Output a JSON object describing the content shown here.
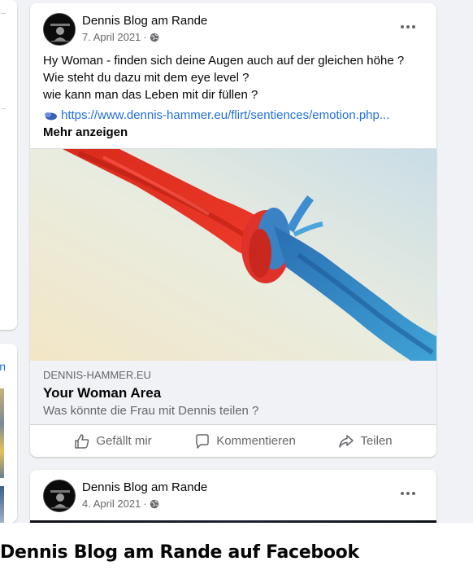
{
  "post1": {
    "page_name": "Dennis Blog am Rande",
    "date": "7. April 2021",
    "meta_sep": "·",
    "lines": [
      "Hy Woman - finden sich deine Augen auch auf der gleichen höhe ?",
      "Wie steht du dazu mit dem eye level ?",
      "wie kann man das Leben mit dir füllen ?"
    ],
    "link": "https://www.dennis-hammer.eu/flirt/sentiences/emotion.php...",
    "see_more": "Mehr anzeigen",
    "preview": {
      "domain": "DENNIS-HAMMER.EU",
      "title": "Your Woman Area",
      "description": "Was könnte die Frau mit Dennis teilen ?"
    }
  },
  "actions": {
    "like": "Gefällt mir",
    "comment": "Kommentieren",
    "share": "Teilen"
  },
  "post2": {
    "page_name": "Dennis Blog am Rande",
    "date": "4. April 2021",
    "meta_sep": "·"
  },
  "left_card_link": "n",
  "footer": {
    "title": "Dennis Blog am Rande auf Facebook"
  },
  "icons": {
    "avatar": "profile-avatar",
    "privacy": "globe-icon",
    "more": "more-options-icon",
    "link": "link-icon",
    "like": "thumbs-up-icon",
    "comment": "comment-icon",
    "share": "share-icon"
  },
  "colors": {
    "link": "#216fdb",
    "secondary_text": "#65676b",
    "background": "#f0f2f5"
  }
}
